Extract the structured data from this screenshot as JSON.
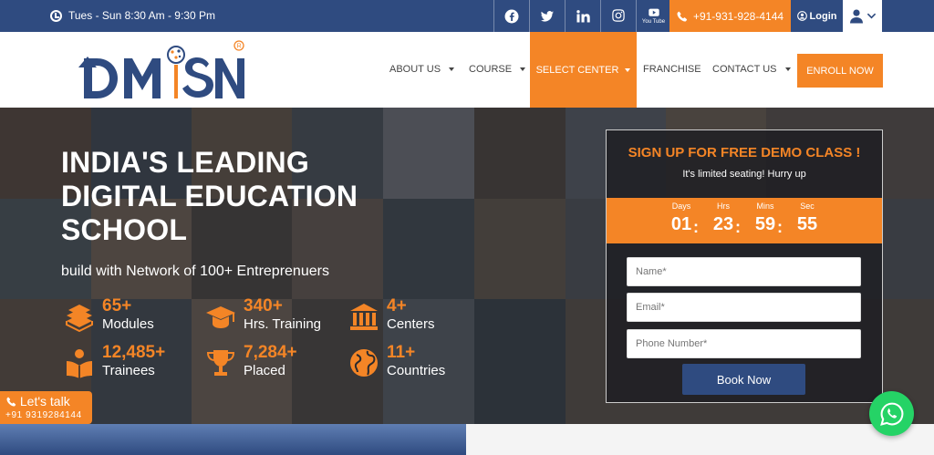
{
  "topbar": {
    "hours": "Tues - Sun 8:30 Am - 9:30 Pm",
    "phone": "+91-931-928-4144",
    "login": "Login",
    "social": [
      "facebook-icon",
      "twitter-icon",
      "linkedin-icon",
      "instagram-icon",
      "youtube-icon"
    ],
    "youtube_label": "You Tube"
  },
  "logo": {
    "text": "DMSN"
  },
  "nav": {
    "about": "ABOUT US",
    "course": "COURSE",
    "select_center": "SELECT CENTER",
    "franchise": "FRANCHISE",
    "contact": "CONTACT US",
    "enroll": "ENROLL NOW"
  },
  "hero": {
    "headline_1": "INDIA'S LEADING",
    "headline_2": "DIGITAL EDUCATION",
    "headline_3": "SCHOOL",
    "subhead": "build with Network of 100+ Entreprenuers",
    "stats": [
      {
        "num": "65+",
        "label": "Modules",
        "icon": "books-icon"
      },
      {
        "num": "340+",
        "label": "Hrs. Training",
        "icon": "graduation-cap-icon"
      },
      {
        "num": "4+",
        "label": "Centers",
        "icon": "building-icon"
      },
      {
        "num": "12,485+",
        "label": "Trainees",
        "icon": "reader-icon"
      },
      {
        "num": "7,284+",
        "label": "Placed",
        "icon": "trophy-icon"
      },
      {
        "num": "11+",
        "label": "Countries",
        "icon": "globe-icon"
      }
    ]
  },
  "signup": {
    "title": "SIGN UP FOR FREE DEMO CLASS !",
    "subtitle": "It's limited seating! Hurry up",
    "countdown": {
      "days_label": "Days",
      "hrs_label": "Hrs",
      "mins_label": "Mins",
      "sec_label": "Sec",
      "days": "01",
      "hrs": "23",
      "mins": "59",
      "sec": "55"
    },
    "name_placeholder": "Name*",
    "email_placeholder": "Email*",
    "phone_placeholder": "Phone Number*",
    "button": "Book Now"
  },
  "letstalk": {
    "title": "Let's talk",
    "phone": "+91 9319284144"
  },
  "colors": {
    "navy": "#2f4b80",
    "orange": "#f48526",
    "whatsapp": "#25d366"
  }
}
